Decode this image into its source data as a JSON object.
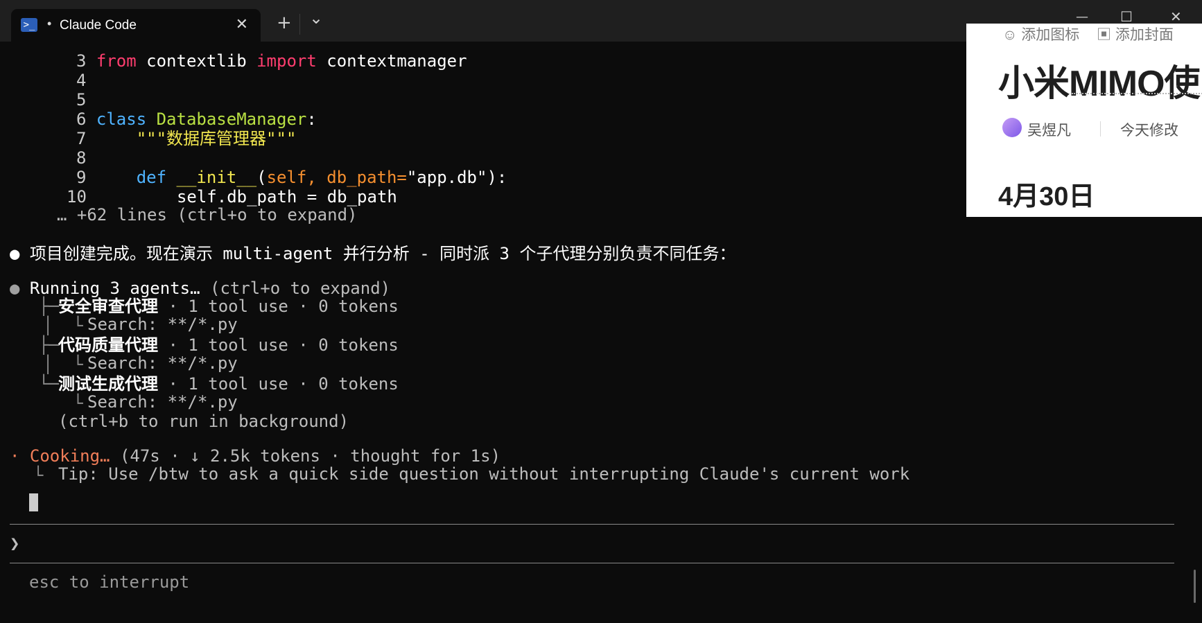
{
  "tab": {
    "title": "Claude Code",
    "new_tab": "+",
    "dropdown": "⌄",
    "close": "✕"
  },
  "window_controls": {
    "minimize": "—",
    "maximize": "☐",
    "close": "✕"
  },
  "code": {
    "lines": [
      {
        "num": "3",
        "kw1": "from",
        "mod": "contextlib",
        "kw2": "import",
        "name": "contextmanager"
      },
      {
        "num": "4"
      },
      {
        "num": "5"
      },
      {
        "num": "6",
        "kw": "class",
        "cls": "DatabaseManager",
        "colon": ":"
      },
      {
        "num": "7",
        "doc": "\"\"\"数据库管理器\"\"\""
      },
      {
        "num": "8"
      },
      {
        "num": "9",
        "kw": "def",
        "fn": "__init__",
        "open": "(",
        "p1": "self,",
        "p2": "db_path=",
        "str": "\"app.db\"",
        "close": "):"
      },
      {
        "num": "10",
        "body": "self.db_path = db_path"
      }
    ],
    "more": "… +62 lines (ctrl+o to expand)"
  },
  "message": {
    "bullet": "●",
    "prefix": "项目创建完成。现在演示",
    "highlight": "multi-agent",
    "suffix": "并行分析 - 同时派 3 个子代理分别负责不同任务："
  },
  "agents": {
    "bullet": "●",
    "header": "Running 3 agents…",
    "header_hint": "(ctrl+o to expand)",
    "items": [
      {
        "name": "安全审查代理",
        "stats": "· 1 tool use · 0 tokens",
        "detail": "Search: **/*.py"
      },
      {
        "name": "代码质量代理",
        "stats": "· 1 tool use · 0 tokens",
        "detail": "Search: **/*.py"
      },
      {
        "name": "测试生成代理",
        "stats": "· 1 tool use · 0 tokens",
        "detail": "Search: **/*.py"
      }
    ],
    "background_hint": "(ctrl+b to run in background)"
  },
  "status": {
    "bullet": "·",
    "label": "Cooking…",
    "details": "(47s · ↓ 2.5k tokens · thought for 1s)",
    "tip": "Tip: Use /btw to ask a quick side question without interrupting Claude's current work"
  },
  "prompt": {
    "symbol": "❯",
    "value": ""
  },
  "footer": {
    "hint": "esc to interrupt"
  },
  "note_window": {
    "add_icon": "添加图标",
    "add_cover": "添加封面",
    "title": "小米MIMO使",
    "author": "吴煜凡",
    "modified": "今天修改",
    "date_heading": "4月30日"
  },
  "colors": {
    "background": "#0c0c0c",
    "keyword_red": "#ff3e6f",
    "keyword_blue": "#4fb3ff",
    "class_green": "#b9e043",
    "status_orange": "#f07e59"
  }
}
